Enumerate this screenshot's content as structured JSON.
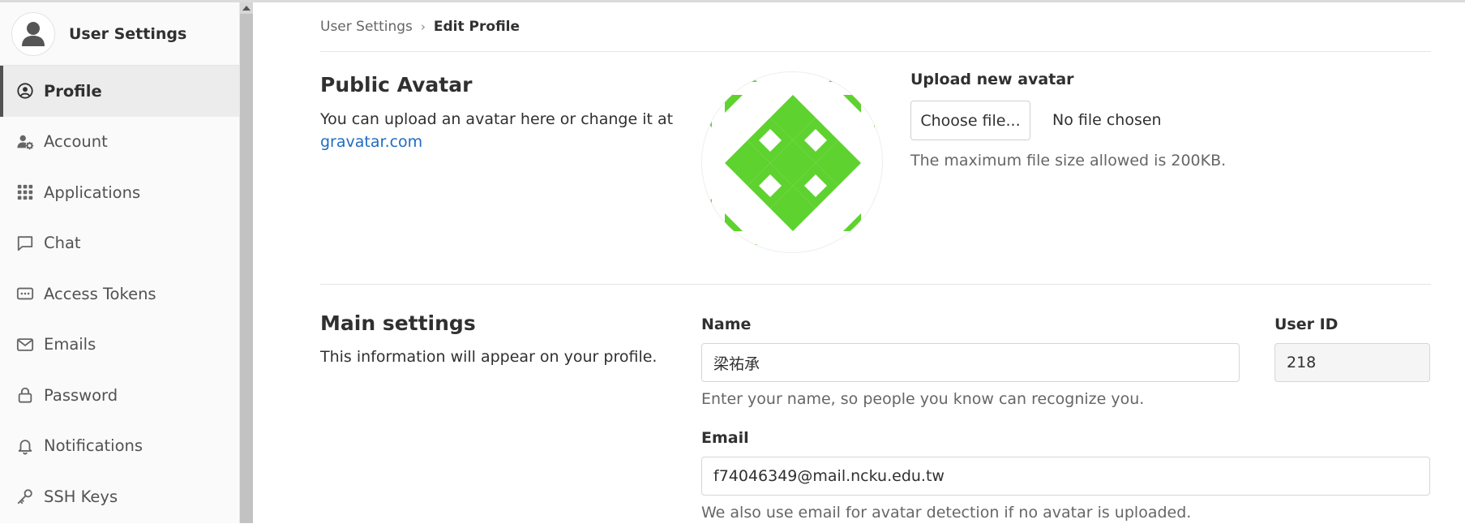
{
  "sidebar": {
    "title": "User Settings",
    "items": [
      {
        "label": "Profile",
        "icon": "profile-icon",
        "active": true
      },
      {
        "label": "Account",
        "icon": "account-icon"
      },
      {
        "label": "Applications",
        "icon": "applications-icon"
      },
      {
        "label": "Chat",
        "icon": "chat-icon"
      },
      {
        "label": "Access Tokens",
        "icon": "access-tokens-icon"
      },
      {
        "label": "Emails",
        "icon": "email-icon"
      },
      {
        "label": "Password",
        "icon": "lock-icon"
      },
      {
        "label": "Notifications",
        "icon": "bell-icon"
      },
      {
        "label": "SSH Keys",
        "icon": "key-icon"
      }
    ]
  },
  "breadcrumb": {
    "parent": "User Settings",
    "current": "Edit Profile"
  },
  "avatar_section": {
    "title": "Public Avatar",
    "description": "You can upload an avatar here or change it at",
    "link_text": "gravatar.com",
    "upload_label": "Upload new avatar",
    "choose_button": "Choose file...",
    "no_file_text": "No file chosen",
    "size_help": "The maximum file size allowed is 200KB.",
    "identicon_color": "#5ed22e"
  },
  "main_settings": {
    "title": "Main settings",
    "description": "This information will appear on your profile.",
    "name_label": "Name",
    "name_value": "梁祐承",
    "name_help": "Enter your name, so people you know can recognize you.",
    "user_id_label": "User ID",
    "user_id_value": "218",
    "email_label": "Email",
    "email_value": "f74046349@mail.ncku.edu.tw",
    "email_help": "We also use email for avatar detection if no avatar is uploaded."
  },
  "colors": {
    "link": "#1f6bc4",
    "active_border": "#525252"
  }
}
